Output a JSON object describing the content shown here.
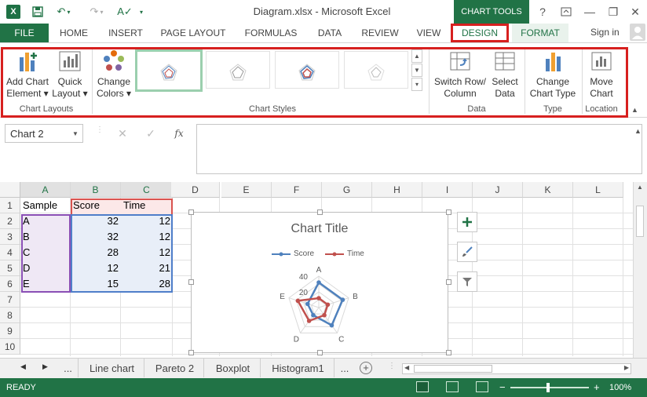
{
  "window": {
    "title": "Diagram.xlsx - Microsoft Excel",
    "context_tab_group": "CHART TOOLS",
    "help": "?",
    "minimize": "—",
    "maximize": "❐",
    "close": "✕"
  },
  "tabs": {
    "file": "FILE",
    "items": [
      "HOME",
      "INSERT",
      "PAGE LAYOUT",
      "FORMULAS",
      "DATA",
      "REVIEW",
      "VIEW"
    ],
    "design": "DESIGN",
    "format": "FORMAT",
    "sign_in": "Sign in"
  },
  "ribbon": {
    "add_chart_element": "Add Chart\nElement",
    "add_chart_element_l1": "Add Chart",
    "add_chart_element_l2": "Element ▾",
    "quick_layout_l1": "Quick",
    "quick_layout_l2": "Layout ▾",
    "change_colors_l1": "Change",
    "change_colors_l2": "Colors ▾",
    "switch_row_col_l1": "Switch Row/",
    "switch_row_col_l2": "Column",
    "select_data_l1": "Select",
    "select_data_l2": "Data",
    "change_chart_type_l1": "Change",
    "change_chart_type_l2": "Chart Type",
    "move_chart_l1": "Move",
    "move_chart_l2": "Chart",
    "group_chart_layouts": "Chart Layouts",
    "group_chart_styles": "Chart Styles",
    "group_data": "Data",
    "group_type": "Type",
    "group_location": "Location"
  },
  "formula_bar": {
    "name_box": "Chart 2",
    "cancel": "✕",
    "enter": "✓",
    "fx": "fx",
    "formula": ""
  },
  "columns": [
    "A",
    "B",
    "C",
    "D",
    "E",
    "F",
    "G",
    "H",
    "I",
    "J",
    "K",
    "L"
  ],
  "rows": [
    "1",
    "2",
    "3",
    "4",
    "5",
    "6",
    "7",
    "8",
    "9",
    "10"
  ],
  "cells": {
    "header": [
      "Sample",
      "Score",
      "Time"
    ],
    "data": [
      [
        "A",
        "32",
        "12"
      ],
      [
        "B",
        "32",
        "12"
      ],
      [
        "C",
        "28",
        "12"
      ],
      [
        "D",
        "12",
        "21"
      ],
      [
        "E",
        "15",
        "28"
      ]
    ]
  },
  "chart": {
    "title": "Chart Title",
    "legend": [
      "Score",
      "Time"
    ],
    "axis_labels": [
      "40",
      "20"
    ],
    "colors": {
      "score": "#4f81bd",
      "time": "#c0504d"
    }
  },
  "chart_data": {
    "type": "radar",
    "title": "Chart Title",
    "categories": [
      "A",
      "B",
      "C",
      "D",
      "E"
    ],
    "series": [
      {
        "name": "Score",
        "values": [
          32,
          32,
          28,
          12,
          15
        ]
      },
      {
        "name": "Time",
        "values": [
          12,
          12,
          12,
          21,
          28
        ]
      }
    ],
    "axis_ticks": [
      20,
      40
    ],
    "rmax": 40,
    "legend_position": "top"
  },
  "sheets": {
    "nav_more": "...",
    "tabs": [
      "Line chart",
      "Pareto 2",
      "Boxplot",
      "Histogram1"
    ],
    "more": "...",
    "add": "+"
  },
  "status": {
    "state": "READY",
    "zoom": "100%",
    "zoom_minus": "−",
    "zoom_plus": "+"
  },
  "theme": {
    "accent": "#217346",
    "highlight": "#d7201f"
  }
}
